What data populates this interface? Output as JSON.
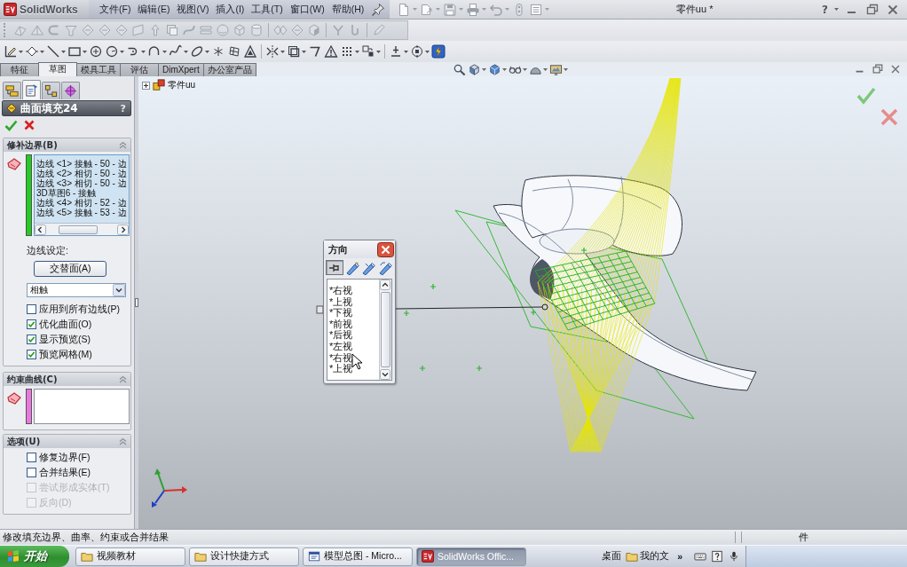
{
  "title_bar": {
    "logo": "SolidWorks",
    "menus": [
      "文件(F)",
      "编辑(E)",
      "视图(V)",
      "插入(I)",
      "工具(T)",
      "窗口(W)",
      "帮助(H)"
    ],
    "document_title": "零件uu *",
    "help": "?"
  },
  "command_tabs": [
    {
      "label": "特征",
      "selected": false
    },
    {
      "label": "草图",
      "selected": true
    },
    {
      "label": "模具工具",
      "selected": false
    },
    {
      "label": "评估",
      "selected": false
    },
    {
      "label": "DimXpert",
      "selected": false
    },
    {
      "label": "办公室产品",
      "selected": false
    }
  ],
  "property_manager": {
    "tabs": [
      {
        "kind": "feature_tree",
        "selected": false
      },
      {
        "kind": "property",
        "selected": true
      },
      {
        "kind": "configuration",
        "selected": false
      },
      {
        "kind": "dimxpert",
        "selected": false
      }
    ],
    "title": "曲面填充24",
    "help": "?",
    "patch_boundary": {
      "title": "修补边界(B)",
      "color": "#22cc22",
      "items": [
        "边线 <1> 接触 - 50 - 边",
        "边线 <2> 相切 - 50 - 边",
        "边线 <3> 相切 - 50 - 边",
        "3D草图6 - 接触",
        "边线 <4> 相切 - 52 - 边",
        "边线 <5> 接触 - 53 - 边"
      ],
      "edge_settings_label": "边线设定:",
      "alternate_button": "交替面(A)",
      "curvature_control": "相触",
      "options": [
        {
          "label": "应用到所有边线(P)",
          "checked": false,
          "disabled": false
        },
        {
          "label": "优化曲面(O)",
          "checked": true,
          "disabled": false
        },
        {
          "label": "显示预览(S)",
          "checked": true,
          "disabled": false
        },
        {
          "label": "预览网格(M)",
          "checked": true,
          "disabled": false
        }
      ]
    },
    "constraint_curves": {
      "title": "约束曲线(C)",
      "color": "#e878e0"
    },
    "options": {
      "title": "选项(U)",
      "options": [
        {
          "label": "修复边界(F)",
          "checked": false,
          "disabled": false
        },
        {
          "label": "合并结果(E)",
          "checked": false,
          "disabled": false
        },
        {
          "label": "尝试形成实体(T)",
          "checked": false,
          "disabled": true
        },
        {
          "label": "反向(D)",
          "checked": false,
          "disabled": true
        }
      ]
    }
  },
  "feature_tree": {
    "root": "零件uu",
    "expanded": false
  },
  "direction_dialog": {
    "title": "方向",
    "pinned": true,
    "views": [
      "*右视",
      "*上视",
      "*下视",
      "*前视",
      "*后视",
      "*左视",
      "*右视",
      "*上视"
    ]
  },
  "status_bar": {
    "message": "修改填充边界、曲率、约束或合并结果",
    "right_text": "件"
  },
  "taskbar": {
    "start": "开始",
    "tasks": [
      {
        "label": "视频教材",
        "kind": "folder",
        "selected": false
      },
      {
        "label": "设计快捷方式",
        "kind": "folder",
        "selected": false
      },
      {
        "label": "模型总图 - Micro...",
        "kind": "document",
        "selected": false
      },
      {
        "label": "SolidWorks Offic...",
        "kind": "solidworks",
        "selected": true
      }
    ],
    "toolbar": [
      {
        "label": "桌面",
        "kind": "text"
      },
      {
        "label": "我的文",
        "kind": "folder"
      }
    ],
    "more": "»"
  }
}
